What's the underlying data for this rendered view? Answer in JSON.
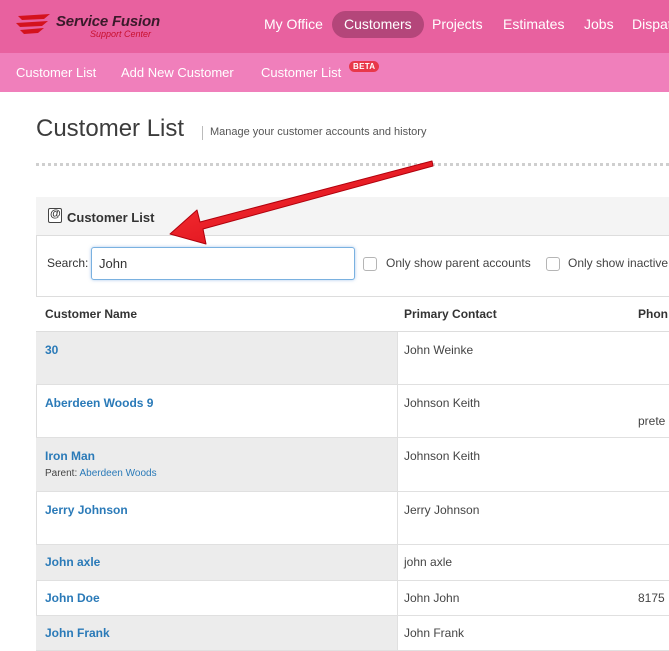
{
  "brand": {
    "name": "Service Fusion",
    "tagline": "Support Center"
  },
  "nav": {
    "items": [
      {
        "label": "My Office",
        "active": false
      },
      {
        "label": "Customers",
        "active": true
      },
      {
        "label": "Projects",
        "active": false
      },
      {
        "label": "Estimates",
        "active": false
      },
      {
        "label": "Jobs",
        "active": false
      },
      {
        "label": "Dispat",
        "active": false
      }
    ]
  },
  "subnav": {
    "items": [
      "Customer List",
      "Add New Customer",
      "Customer List"
    ],
    "beta_badge": "BETA"
  },
  "page": {
    "title": "Customer List",
    "subtitle": "Manage your customer accounts and history"
  },
  "panel": {
    "title": "Customer List",
    "icon": "address-book-icon",
    "search_label": "Search:",
    "search_value": "John",
    "filter_parent": "Only show parent accounts",
    "filter_inactive": "Only show inactive"
  },
  "table": {
    "headers": [
      "Customer Name",
      "Primary Contact",
      "Phon"
    ],
    "rows": [
      {
        "name": "30",
        "parent_label": "",
        "parent_name": "",
        "contact": "John Weinke",
        "phone": ""
      },
      {
        "name": "Aberdeen Woods 9",
        "parent_label": "",
        "parent_name": "",
        "contact": "Johnson Keith",
        "phone": "prete"
      },
      {
        "name": "Iron Man",
        "parent_label": "Parent:",
        "parent_name": "Aberdeen Woods",
        "contact": "Johnson Keith",
        "phone": ""
      },
      {
        "name": "Jerry Johnson",
        "parent_label": "",
        "parent_name": "",
        "contact": "Jerry Johnson",
        "phone": ""
      },
      {
        "name": "John axle",
        "parent_label": "",
        "parent_name": "",
        "contact": "john axle",
        "phone": ""
      },
      {
        "name": "John Doe",
        "parent_label": "",
        "parent_name": "",
        "contact": "John John",
        "phone": "8175"
      },
      {
        "name": "John Frank",
        "parent_label": "",
        "parent_name": "",
        "contact": "John Frank",
        "phone": ""
      }
    ]
  },
  "colors": {
    "nav_bg": "#e8619f",
    "subnav_bg": "#f07fbb",
    "link": "#2a7ab8",
    "annotation_arrow": "#e8101a"
  }
}
